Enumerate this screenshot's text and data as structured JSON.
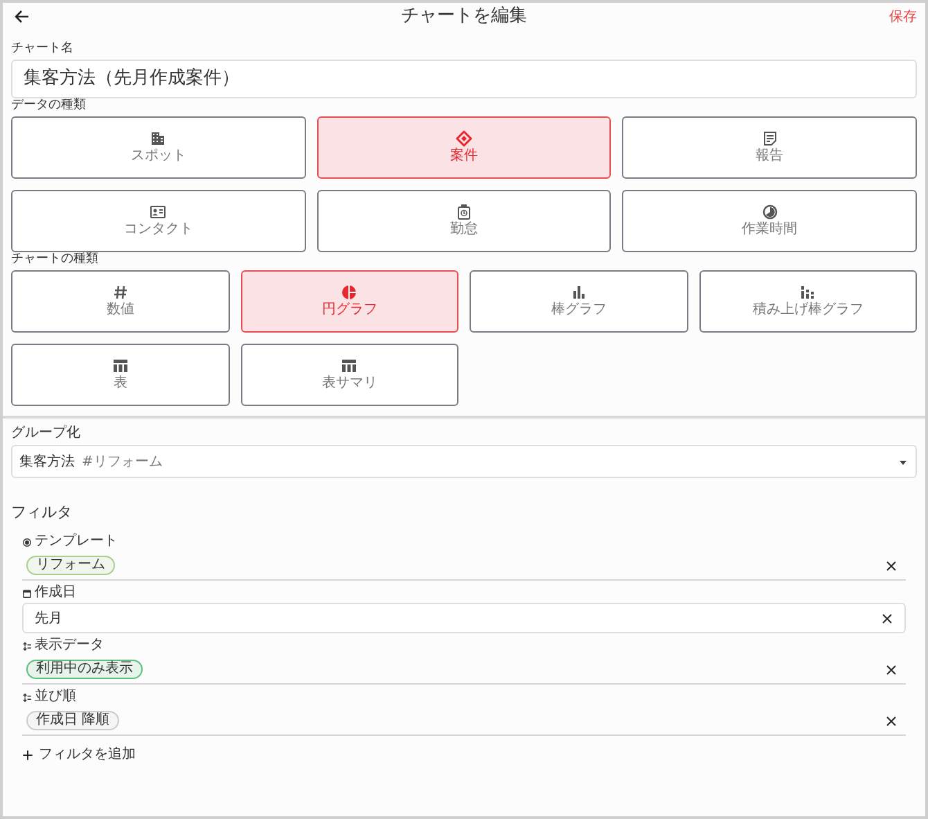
{
  "header": {
    "title": "チャートを編集",
    "save": "保存"
  },
  "chart_name": {
    "label": "チャート名",
    "value": "集客方法（先月作成案件）"
  },
  "data_type": {
    "label": "データの種類",
    "options": [
      {
        "label": "スポット",
        "selected": false
      },
      {
        "label": "案件",
        "selected": true
      },
      {
        "label": "報告",
        "selected": false
      },
      {
        "label": "コンタクト",
        "selected": false
      },
      {
        "label": "勤怠",
        "selected": false
      },
      {
        "label": "作業時間",
        "selected": false
      }
    ]
  },
  "chart_type": {
    "label": "チャートの種類",
    "options": [
      {
        "label": "数値",
        "selected": false
      },
      {
        "label": "円グラフ",
        "selected": true
      },
      {
        "label": "棒グラフ",
        "selected": false
      },
      {
        "label": "積み上げ棒グラフ",
        "selected": false
      },
      {
        "label": "表",
        "selected": false
      },
      {
        "label": "表サマリ",
        "selected": false
      }
    ]
  },
  "grouping": {
    "label": "グループ化",
    "value": "集客方法",
    "tag": "#リフォーム"
  },
  "filters": {
    "heading": "フィルタ",
    "items": [
      {
        "kind": "chip",
        "label": "テンプレート",
        "value": "リフォーム",
        "color": "#a8d08d"
      },
      {
        "kind": "field",
        "label": "作成日",
        "value": "先月"
      },
      {
        "kind": "chip",
        "label": "表示データ",
        "value": "利用中のみ表示",
        "color": "#5cc080"
      },
      {
        "kind": "chip",
        "label": "並び順",
        "value": "作成日 降順",
        "color": "#cccccc"
      }
    ],
    "add_label": "フィルタを追加"
  }
}
